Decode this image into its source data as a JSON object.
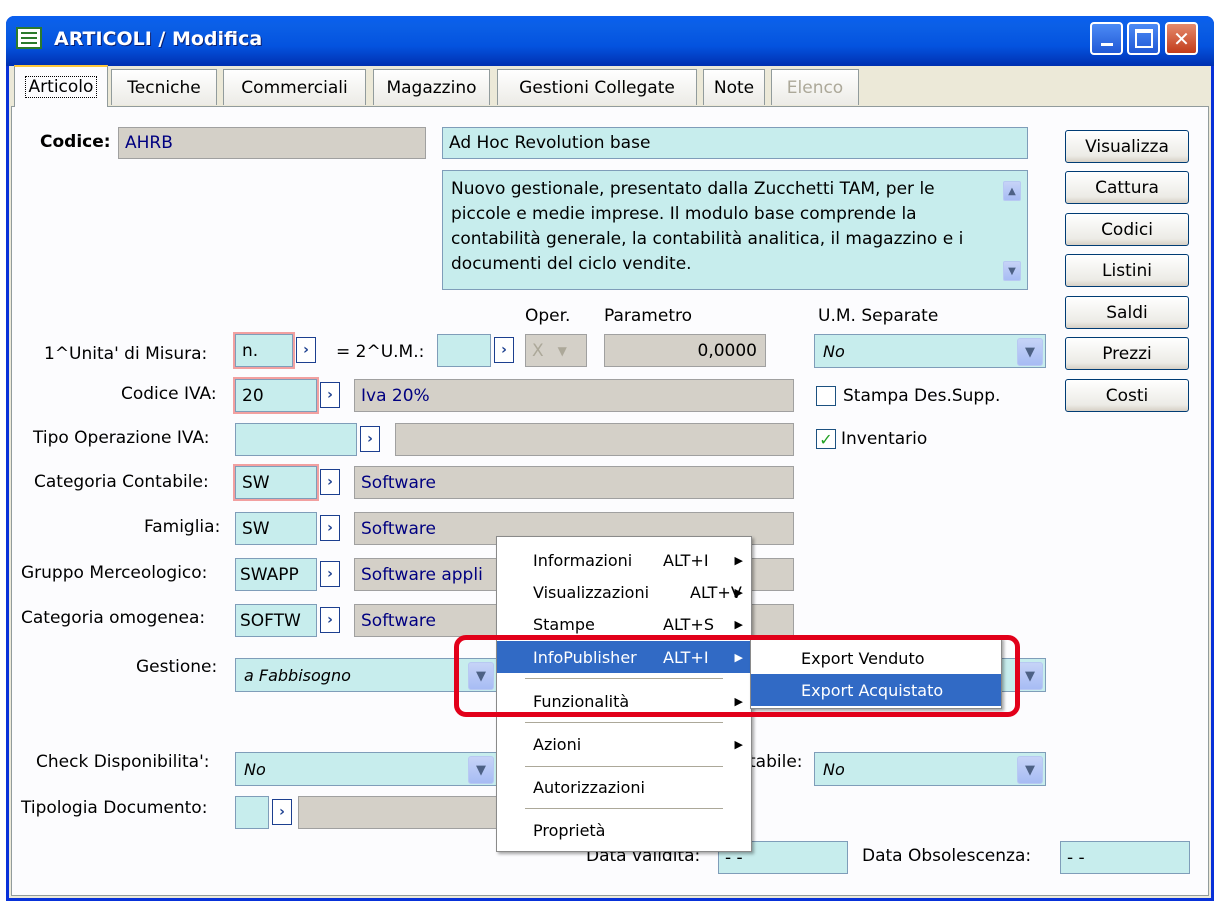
{
  "window": {
    "title": "ARTICOLI / Modifica"
  },
  "tabs": [
    "Articolo",
    "Tecniche",
    "Commerciali",
    "Magazzino",
    "Gestioni Collegate",
    "Note",
    "Elenco"
  ],
  "codice": {
    "label": "Codice:",
    "value": "AHRB",
    "description": "Ad Hoc Revolution base"
  },
  "note_text": "Nuovo gestionale, presentato dalla Zucchetti TAM, per le piccole e medie imprese. Il modulo base comprende la contabilità generale, la contabilità analitica, il magazzino e i documenti del ciclo vendite.",
  "unit": {
    "oper_label": "Oper.",
    "param_label": "Parametro",
    "um_sep_label": "U.M. Separate",
    "um1_label": "1^Unita' di Misura:",
    "um1_value": "n.",
    "um2_label": "= 2^U.M.:",
    "um2_value": "",
    "oper_value": "X",
    "param_value": "0,0000",
    "um_sep_value": "No"
  },
  "iva": {
    "label": "Codice IVA:",
    "code": "20",
    "desc": "Iva 20%"
  },
  "tipo_op": {
    "label": "Tipo Operazione IVA:",
    "code": "",
    "desc": ""
  },
  "cat_cont": {
    "label": "Categoria Contabile:",
    "code": "SW",
    "desc": "Software"
  },
  "famiglia": {
    "label": "Famiglia:",
    "code": "SW",
    "desc": "Software"
  },
  "gruppo": {
    "label": "Gruppo Merceologico:",
    "code": "SWAPP",
    "desc": "Software appli"
  },
  "cat_omo": {
    "label": "Categoria omogenea:",
    "code": "SOFTW",
    "desc": "Software"
  },
  "gestione": {
    "label": "Gestione:",
    "value": "a Fabbisogno"
  },
  "check_disp": {
    "label": "Check Disponibilita':",
    "value": "No"
  },
  "contabile": {
    "label": "tabile:",
    "value": "No"
  },
  "tipologia": {
    "label": "Tipologia Documento:",
    "code": ""
  },
  "data_validita": {
    "label": "Data validita:",
    "value": "- -"
  },
  "data_obs": {
    "label": "Data Obsolescenza:",
    "value": "- -"
  },
  "checkboxes": {
    "stampa": "Stampa Des.Supp.",
    "inventario": "Inventario"
  },
  "side_buttons": [
    "Visualizza",
    "Cattura",
    "Codici",
    "Listini",
    "Saldi",
    "Prezzi",
    "Costi"
  ],
  "context_menu": [
    {
      "label": "Informazioni",
      "shortcut": "ALT+I"
    },
    {
      "label": "Visualizzazioni",
      "shortcut": "ALT+V"
    },
    {
      "label": "Stampe",
      "shortcut": "ALT+S"
    },
    {
      "label": "InfoPublisher",
      "shortcut": "ALT+I"
    },
    {
      "label": "Funzionalità",
      "shortcut": ""
    },
    {
      "label": "Azioni",
      "shortcut": ""
    },
    {
      "label": "Autorizzazioni",
      "shortcut": ""
    },
    {
      "label": "Proprietà",
      "shortcut": ""
    }
  ],
  "submenu": [
    "Export Venduto",
    "Export Acquistato"
  ],
  "colors": {
    "highlight": "#e2001a",
    "field_bg": "#c7eded",
    "menu_hl": "#316ac5"
  }
}
